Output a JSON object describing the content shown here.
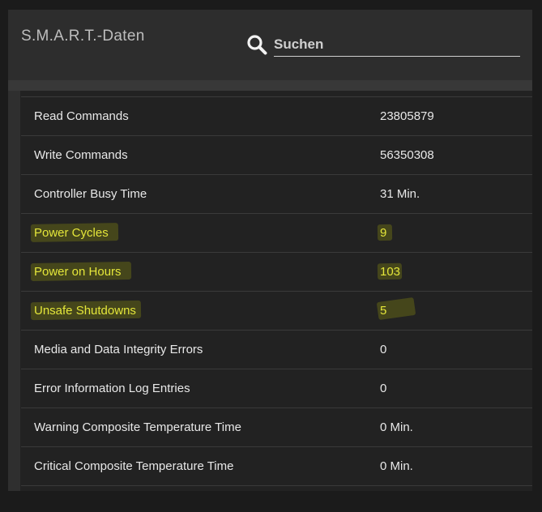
{
  "header": {
    "title": "S.M.A.R.T.-Daten",
    "search": {
      "placeholder": "Suchen",
      "value": "",
      "icon": "search-icon"
    }
  },
  "table": {
    "rows": [
      {
        "label": "Read Commands",
        "value": "23805879",
        "highlighted": false
      },
      {
        "label": "Write Commands",
        "value": "56350308",
        "highlighted": false
      },
      {
        "label": "Controller Busy Time",
        "value": "31 Min.",
        "highlighted": false
      },
      {
        "label": "Power Cycles",
        "value": "9",
        "highlighted": true
      },
      {
        "label": "Power on Hours",
        "value": "103",
        "highlighted": true
      },
      {
        "label": "Unsafe Shutdowns",
        "value": "5",
        "highlighted": true
      },
      {
        "label": "Media and Data Integrity Errors",
        "value": "0",
        "highlighted": false
      },
      {
        "label": "Error Information Log Entries",
        "value": "0",
        "highlighted": false
      },
      {
        "label": "Warning Composite Temperature Time",
        "value": "0 Min.",
        "highlighted": false
      },
      {
        "label": "Critical Composite Temperature Time",
        "value": "0 Min.",
        "highlighted": false
      }
    ]
  },
  "colors": {
    "background": "#1b1b1b",
    "panel": "#232323",
    "header": "#2d2d2d",
    "text": "#e8e8e8",
    "highlight_text": "#e4e63a",
    "divider": "#3a3a3a"
  }
}
